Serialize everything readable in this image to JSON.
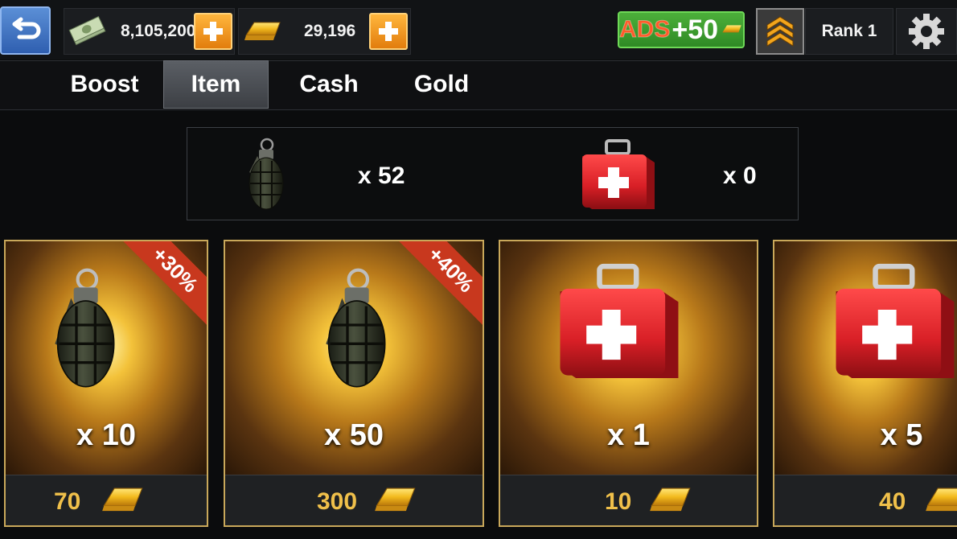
{
  "topbar": {
    "cash_amount": "8,105,200",
    "gold_amount": "29,196",
    "ads_label": "ADS",
    "ads_bonus": "+50",
    "rank_label": "Rank 1"
  },
  "tabs": [
    {
      "label": "Boost",
      "active": false
    },
    {
      "label": "Item",
      "active": true
    },
    {
      "label": "Cash",
      "active": false
    },
    {
      "label": "Gold",
      "active": false
    }
  ],
  "inventory": {
    "grenade_count": "x 52",
    "medkit_count": "x 0"
  },
  "cards": [
    {
      "item": "grenade",
      "qty": "x 10",
      "price": "70",
      "badge": "+30%"
    },
    {
      "item": "grenade",
      "qty": "x 50",
      "price": "300",
      "badge": "+40%"
    },
    {
      "item": "medkit",
      "qty": "x 1",
      "price": "10",
      "badge": ""
    },
    {
      "item": "medkit",
      "qty": "x 5",
      "price": "40",
      "badge": ""
    }
  ],
  "colors": {
    "accent_gold": "#f0c04a",
    "plus_orange": "#f39a1e",
    "ribbon_red": "#c8381e",
    "medkit_red": "#d81f26"
  },
  "icons": {
    "back": "back-arrow-icon",
    "cash": "cash-icon",
    "gold": "gold-bar-icon",
    "plus": "plus-icon",
    "rank": "rank-chevron-icon",
    "settings": "gear-icon",
    "grenade": "grenade-icon",
    "medkit": "medkit-icon"
  }
}
